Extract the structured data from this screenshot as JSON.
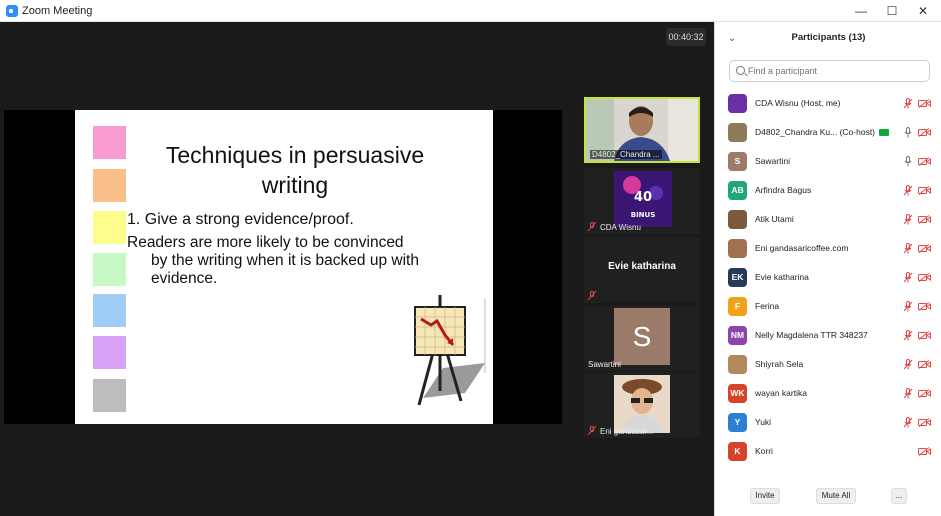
{
  "window": {
    "title": "Zoom Meeting",
    "minimize": "—",
    "maximize": "☐",
    "close": "✕"
  },
  "meeting": {
    "timer": "00:40:32"
  },
  "slide": {
    "title_line1": "Techniques in persuasive",
    "title_line2": "writing",
    "point": "1.  Give a strong evidence/proof.",
    "body_line1": "Readers are more likely to be convinced",
    "body_line2": "by the writing when it is backed up with",
    "body_line3": "evidence.",
    "swatch_colors": [
      "#f79bd1",
      "#fbbf8c",
      "#fcfd8a",
      "#c7f9c4",
      "#9fcdf8",
      "#d9a1f5",
      "#bdbdbd"
    ]
  },
  "video_tiles": [
    {
      "name": "D4802_Chandra ...",
      "active": true,
      "muted": false
    },
    {
      "name": "CDA Wisnu",
      "active": false,
      "muted": true
    },
    {
      "name": "Evie katharina",
      "center_name": "Evie katharina",
      "active": false,
      "muted": true
    },
    {
      "name": "Sawartini",
      "letter": "S",
      "active": false,
      "muted": false
    },
    {
      "name": "Eni gandasar...",
      "active": false,
      "muted": true
    }
  ],
  "participants_panel": {
    "title": "Participants (13)",
    "search_placeholder": "Find a participant",
    "participants": [
      {
        "name": "CDA Wisnu (Host, me)",
        "initials": "",
        "color": "#6b2fa6",
        "mic": "muted",
        "video": "off"
      },
      {
        "name": "D4802_Chandra Ku...  (Co-host)",
        "initials": "",
        "color": "#8c7a5a",
        "mic": "on",
        "video": "off",
        "sharing": true
      },
      {
        "name": "Sawartini",
        "initials": "S",
        "color": "#9c7b68",
        "mic": "on",
        "video": "off"
      },
      {
        "name": "Arfindra Bagus",
        "initials": "AB",
        "color": "#1fa67a",
        "mic": "muted",
        "video": "off"
      },
      {
        "name": "Atik Utami",
        "initials": "",
        "color": "#7a5a3a",
        "mic": "muted",
        "video": "off"
      },
      {
        "name": "Eni gandasaricoffee.com",
        "initials": "",
        "color": "#a07050",
        "mic": "muted",
        "video": "off"
      },
      {
        "name": "Evie katharina",
        "initials": "EK",
        "color": "#253a58",
        "mic": "muted",
        "video": "off"
      },
      {
        "name": "Ferina",
        "initials": "F",
        "color": "#f0a21b",
        "mic": "muted",
        "video": "off"
      },
      {
        "name": "Nelly Magdalena TTR 348237",
        "initials": "NM",
        "color": "#8e44ad",
        "mic": "muted",
        "video": "off"
      },
      {
        "name": "Shiyrah Sela",
        "initials": "",
        "color": "#b08a5a",
        "mic": "muted",
        "video": "off"
      },
      {
        "name": "wayan kartika",
        "initials": "WK",
        "color": "#d6432b",
        "mic": "muted",
        "video": "off"
      },
      {
        "name": "Yuki",
        "initials": "Y",
        "color": "#2c7fd1",
        "mic": "muted",
        "video": "off"
      },
      {
        "name": "Korri",
        "initials": "K",
        "color": "#d6432b",
        "mic": "none",
        "video": "off"
      }
    ],
    "buttons": {
      "invite": "Invite",
      "mute_all": "Mute All",
      "more": "..."
    }
  }
}
